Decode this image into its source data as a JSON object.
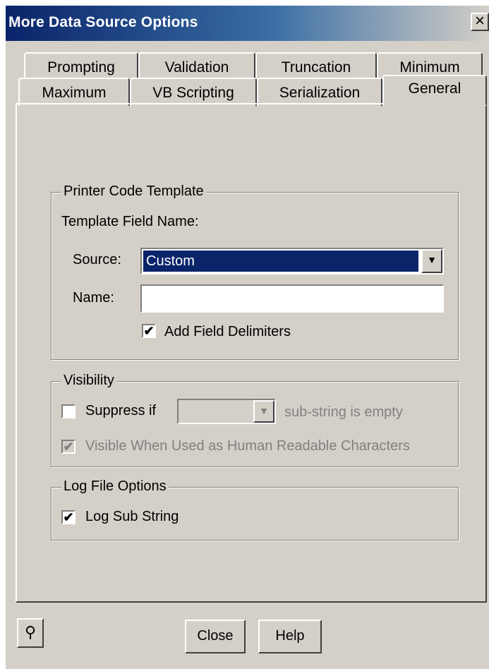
{
  "window": {
    "title": "More Data Source Options",
    "close_glyph": "×"
  },
  "tabs": {
    "row1": [
      "Prompting",
      "Validation",
      "Truncation",
      "Minimum"
    ],
    "row2": [
      "Maximum",
      "VB Scripting",
      "Serialization",
      "General"
    ],
    "active": "General"
  },
  "printer_code_template": {
    "legend": "Printer Code Template",
    "template_field_name_label": "Template Field Name:",
    "source_label": "Source:",
    "source_value": "Custom",
    "name_label": "Name:",
    "name_value": "",
    "add_field_delimiters_label": "Add Field Delimiters",
    "add_field_delimiters_checked": true
  },
  "visibility": {
    "legend": "Visibility",
    "suppress_if_label": "Suppress if",
    "suppress_if_checked": false,
    "suppress_value": "",
    "substring_empty_label": "sub-string is empty",
    "visible_human_readable_label": "Visible When Used as Human Readable Characters",
    "visible_human_readable_checked": true
  },
  "log_file_options": {
    "legend": "Log File Options",
    "log_sub_string_label": "Log Sub String",
    "log_sub_string_checked": true
  },
  "footer": {
    "close_label": "Close",
    "help_label": "Help",
    "pin_icon": "pin-icon"
  },
  "colors": {
    "face": "#d4d0c8",
    "title_start": "#0a246a",
    "title_end": "#3a6ea5",
    "selection": "#0a246a"
  }
}
